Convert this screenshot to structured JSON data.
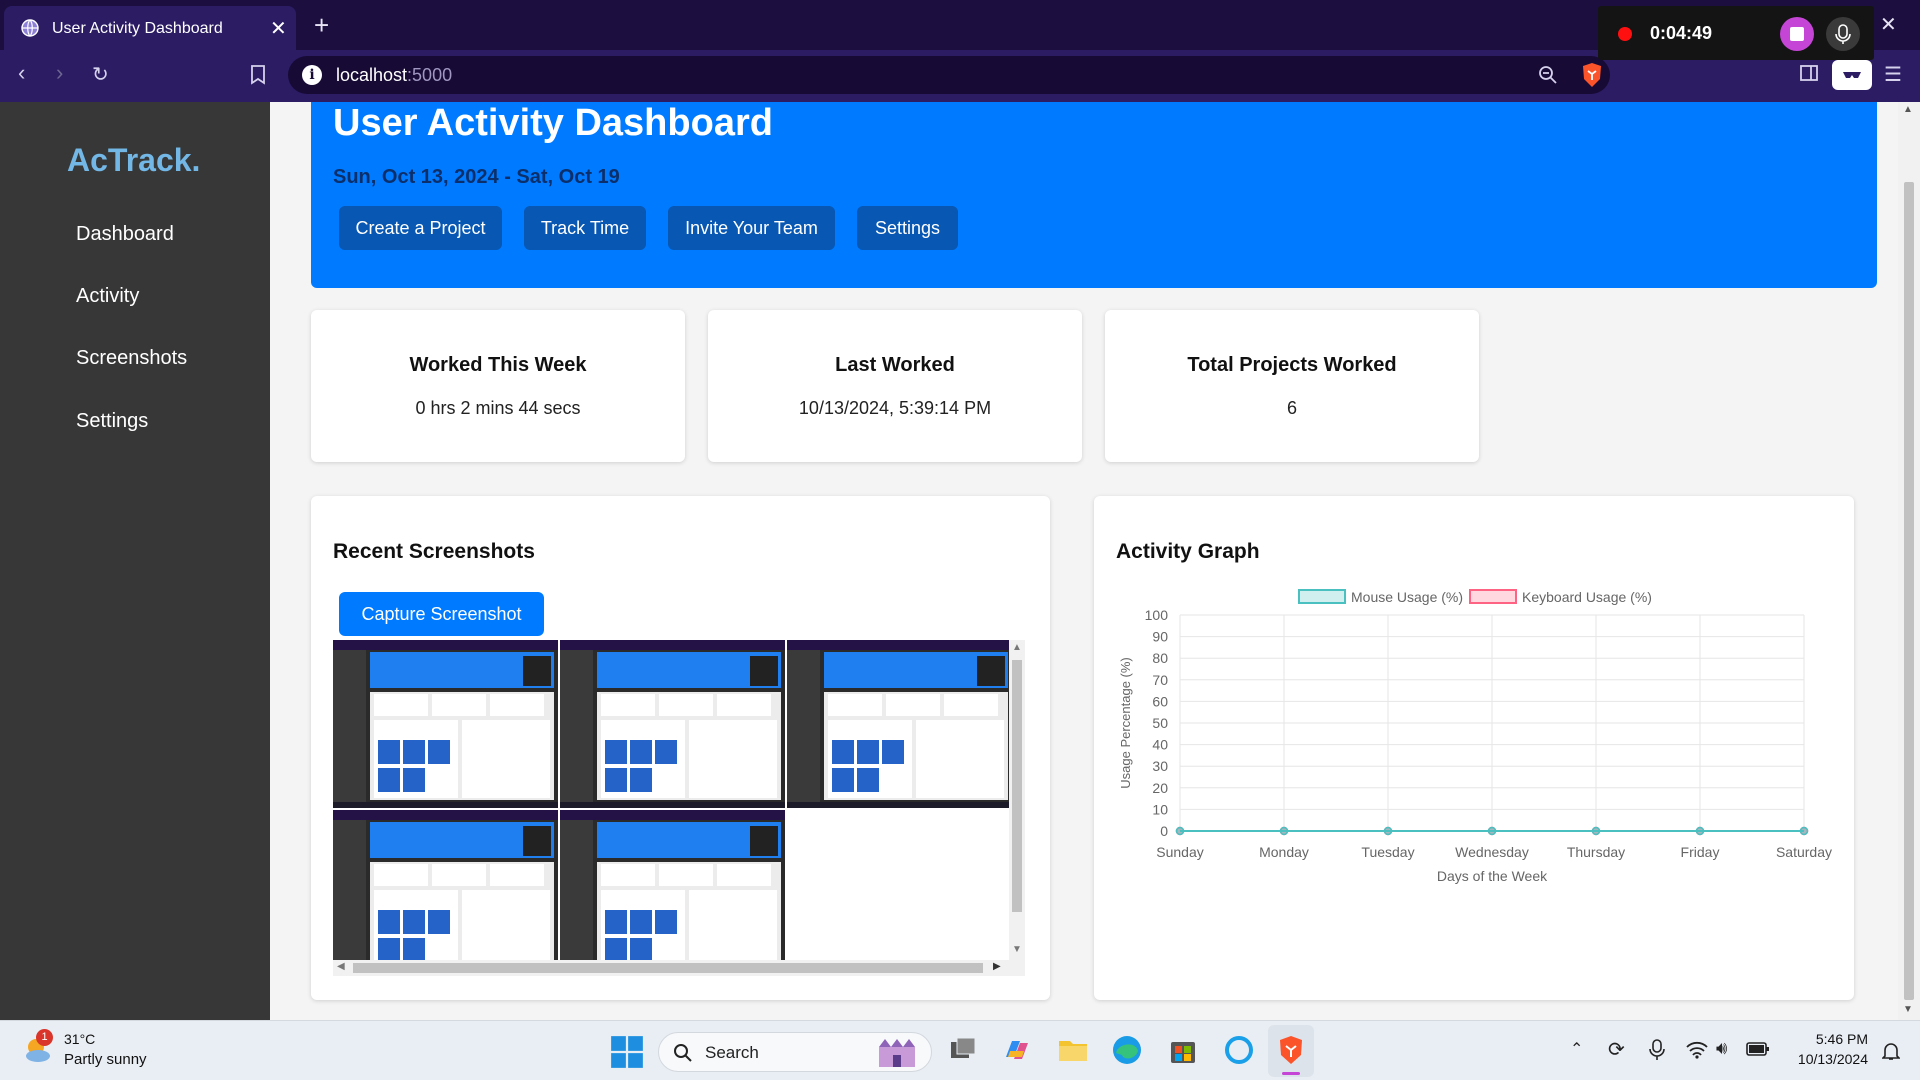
{
  "browser": {
    "tab_title": "User Activity Dashboard",
    "url_host": "localhost",
    "url_port": ":5000"
  },
  "sidebar": {
    "logo": "AcTrack.",
    "items": [
      {
        "label": "Dashboard"
      },
      {
        "label": "Activity"
      },
      {
        "label": "Screenshots"
      },
      {
        "label": "Settings"
      }
    ]
  },
  "header": {
    "title": "User Activity Dashboard",
    "date_range": "Sun, Oct 13, 2024 - Sat, Oct 19",
    "buttons": [
      {
        "label": "Create a Project"
      },
      {
        "label": "Track Time"
      },
      {
        "label": "Invite Your Team"
      },
      {
        "label": "Settings"
      }
    ]
  },
  "recorder": {
    "elapsed": "0:04:49",
    "colors": {
      "dot": "#ff1010",
      "stop": "#c546d6"
    }
  },
  "stats": [
    {
      "title": "Worked This Week",
      "value": "0 hrs 2 mins 44 secs"
    },
    {
      "title": "Last Worked",
      "value": "10/13/2024, 5:39:14 PM"
    },
    {
      "title": "Total Projects Worked",
      "value": "6"
    }
  ],
  "screenshots": {
    "title": "Recent Screenshots",
    "capture_label": "Capture Screenshot",
    "count": 5
  },
  "activity": {
    "title": "Activity Graph"
  },
  "chart_data": {
    "type": "line",
    "title": "",
    "xlabel": "Days of the Week",
    "ylabel": "Usage Percentage (%)",
    "categories": [
      "Sunday",
      "Monday",
      "Tuesday",
      "Wednesday",
      "Thursday",
      "Friday",
      "Saturday"
    ],
    "ylim": [
      0,
      100
    ],
    "yticks": [
      0,
      10,
      20,
      30,
      40,
      50,
      60,
      70,
      80,
      90,
      100
    ],
    "grid": true,
    "legend_position": "top",
    "series": [
      {
        "name": "Mouse Usage (%)",
        "values": [
          0,
          0,
          0,
          0,
          0,
          0,
          0
        ],
        "color": "#4bc0c0"
      },
      {
        "name": "Keyboard Usage (%)",
        "values": [
          0,
          0,
          0,
          0,
          0,
          0,
          0
        ],
        "color": "#ff6384"
      }
    ]
  },
  "taskbar": {
    "weather_temp": "31°C",
    "weather_desc": "Partly sunny",
    "weather_badge": "1",
    "search_label": "Search",
    "time": "5:46 PM",
    "date": "10/13/2024"
  },
  "colors": {
    "accent": "#007bff",
    "sidebar": "#373737",
    "browser_frame": "#1c0f3f"
  }
}
